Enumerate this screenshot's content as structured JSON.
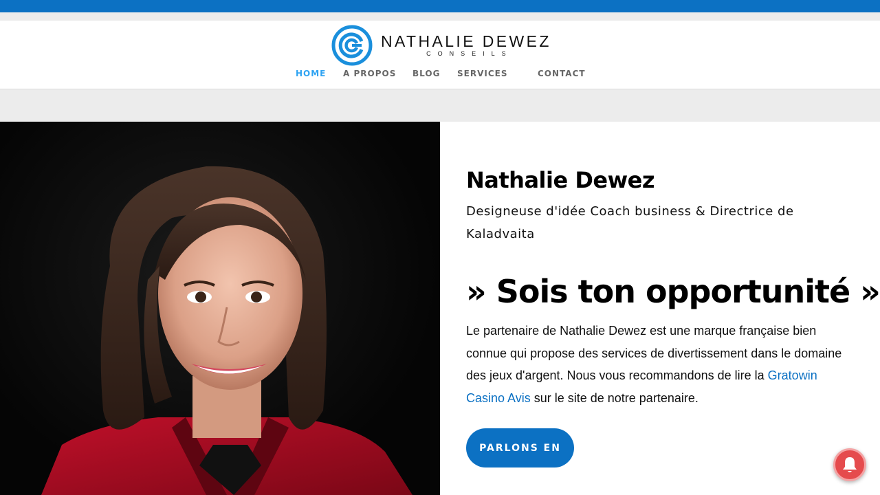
{
  "colors": {
    "brand_blue": "#0c71c3",
    "nav_active": "#2ea3f2",
    "nav_text": "#666666",
    "notify_red": "#e54b4d"
  },
  "logo": {
    "name": "NATHALIE DEWEZ",
    "subtitle": "CONSEILS"
  },
  "nav": {
    "items": [
      {
        "label": "HOME",
        "active": true
      },
      {
        "label": "A PROPOS",
        "active": false
      },
      {
        "label": "BLOG",
        "active": false
      },
      {
        "label": "SERVICES",
        "active": false
      },
      {
        "label": "CONTACT",
        "active": false
      }
    ]
  },
  "hero": {
    "name": "Nathalie Dewez",
    "role": "Designeuse d'idée Coach business & Directrice de Kaladvaita",
    "slogan": "» Sois ton opportunité  »",
    "paragraph_before": "Le partenaire de Nathalie Dewez est une marque française bien connue qui propose des services de divertissement dans le domaine des jeux d'argent. Nous vous recommandons de lire la ",
    "link_text": "Gratowin Casino Avis",
    "paragraph_after": " sur le site de notre partenaire.",
    "cta_label": "PARLONS EN"
  },
  "icons": {
    "notification": "bell-icon",
    "logo_mark": "maze-logo-icon"
  }
}
